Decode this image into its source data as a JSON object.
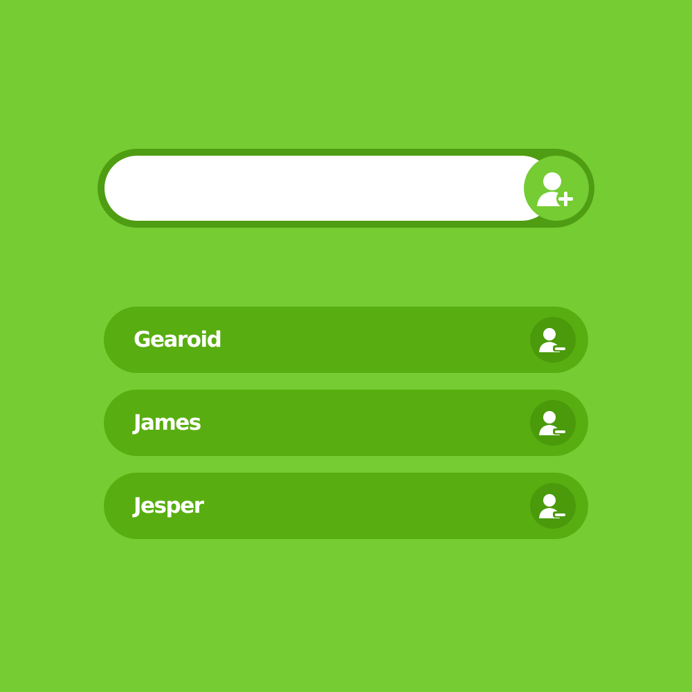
{
  "add_bar": {
    "input_value": "",
    "input_placeholder": "",
    "add_icon": "add-user-icon"
  },
  "people": [
    {
      "name": "Gearoid",
      "remove_icon": "remove-user-icon"
    },
    {
      "name": "James",
      "remove_icon": "remove-user-icon"
    },
    {
      "name": "Jesper",
      "remove_icon": "remove-user-icon"
    }
  ],
  "colors": {
    "background": "#76cc33",
    "bar_border": "#4f9d12",
    "row": "#58ae10",
    "row_button": "#4a9a0c",
    "text": "#ffffff"
  }
}
